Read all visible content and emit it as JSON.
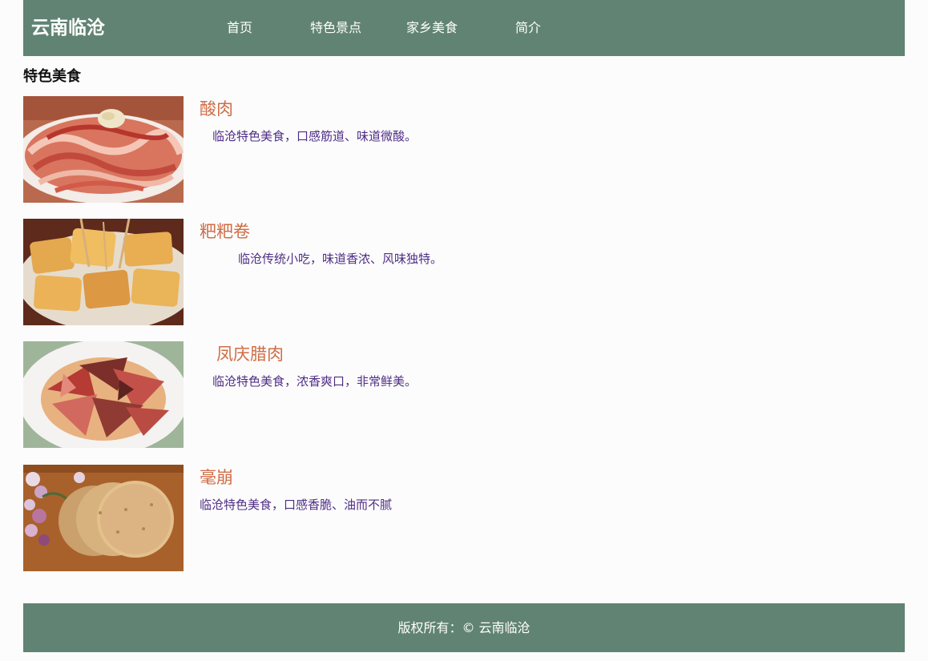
{
  "header": {
    "site_title": "云南临沧",
    "nav": [
      "首页",
      "特色景点",
      "家乡美食",
      "简介"
    ]
  },
  "section_title": "特色美食",
  "foods": [
    {
      "name": "酸肉",
      "desc": "临沧特色美食，口感筋道、味道微酸。",
      "image_icon": "sour-meat-photo"
    },
    {
      "name": "粑粑卷",
      "desc": "临沧传统小吃，味道香浓、风味独特。",
      "image_icon": "baba-roll-photo"
    },
    {
      "name": "凤庆腊肉",
      "desc": "临沧特色美食，浓香爽口，非常鲜美。",
      "image_icon": "cured-pork-photo"
    },
    {
      "name": "毫崩",
      "desc": "临沧特色美食，口感香脆、油而不腻",
      "image_icon": "rice-cracker-photo"
    }
  ],
  "footer": {
    "copyright": "版权所有：© 云南临沧"
  },
  "colors": {
    "header_bg": "#618373",
    "page_bg": "#fcfcfc",
    "food_title": "#cf6d46",
    "food_desc": "#4f2e86"
  }
}
